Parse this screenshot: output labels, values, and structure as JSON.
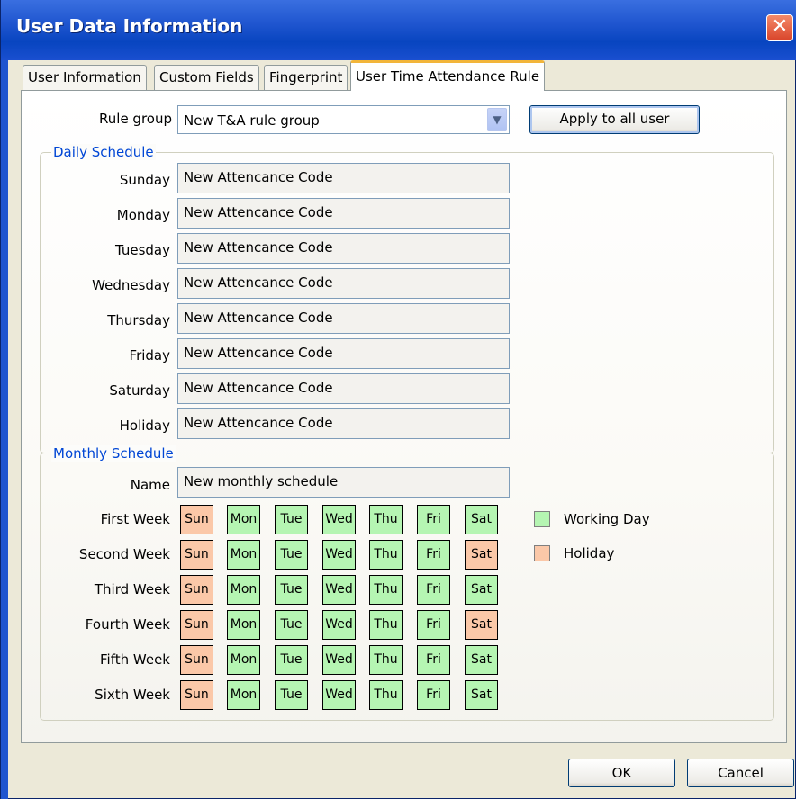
{
  "window": {
    "title": "User Data Information",
    "close_glyph": "✕"
  },
  "tabs": [
    {
      "label": "User Information"
    },
    {
      "label": "Custom Fields"
    },
    {
      "label": "Fingerprint"
    },
    {
      "label": "User Time Attendance Rule"
    }
  ],
  "rule_group": {
    "label": "Rule group",
    "value": "New T&A rule group",
    "apply_label": "Apply to all user"
  },
  "daily": {
    "title": "Daily Schedule",
    "rows": [
      {
        "day": "Sunday",
        "code": "New Attencance Code"
      },
      {
        "day": "Monday",
        "code": "New Attencance Code"
      },
      {
        "day": "Tuesday",
        "code": "New Attencance Code"
      },
      {
        "day": "Wednesday",
        "code": "New Attencance Code"
      },
      {
        "day": "Thursday",
        "code": "New Attencance Code"
      },
      {
        "day": "Friday",
        "code": "New Attencance Code"
      },
      {
        "day": "Saturday",
        "code": "New Attencance Code"
      },
      {
        "day": "Holiday",
        "code": "New Attencance Code"
      }
    ]
  },
  "monthly": {
    "title": "Monthly Schedule",
    "name_label": "Name",
    "name_value": "New monthly schedule",
    "day_labels": [
      "Sun",
      "Mon",
      "Tue",
      "Wed",
      "Thu",
      "Fri",
      "Sat"
    ],
    "weeks": [
      {
        "label": "First Week",
        "days": [
          "holiday",
          "working",
          "working",
          "working",
          "working",
          "working",
          "working"
        ]
      },
      {
        "label": "Second Week",
        "days": [
          "holiday",
          "working",
          "working",
          "working",
          "working",
          "working",
          "holiday"
        ]
      },
      {
        "label": "Third Week",
        "days": [
          "holiday",
          "working",
          "working",
          "working",
          "working",
          "working",
          "working"
        ]
      },
      {
        "label": "Fourth Week",
        "days": [
          "holiday",
          "working",
          "working",
          "working",
          "working",
          "working",
          "holiday"
        ]
      },
      {
        "label": "Fifth Week",
        "days": [
          "holiday",
          "working",
          "working",
          "working",
          "working",
          "working",
          "working"
        ]
      },
      {
        "label": "Sixth Week",
        "days": [
          "holiday",
          "working",
          "working",
          "working",
          "working",
          "working",
          "working"
        ]
      }
    ],
    "legend": [
      {
        "label": "Working Day",
        "color": "#b5f5b2"
      },
      {
        "label": "Holiday",
        "color": "#fbc8a8"
      }
    ]
  },
  "colors": {
    "working": "#b5f5b2",
    "holiday": "#fbc8a8",
    "title_bar": "#1f55cf",
    "group_title": "#0046d5"
  },
  "buttons": {
    "ok": "OK",
    "cancel": "Cancel"
  }
}
